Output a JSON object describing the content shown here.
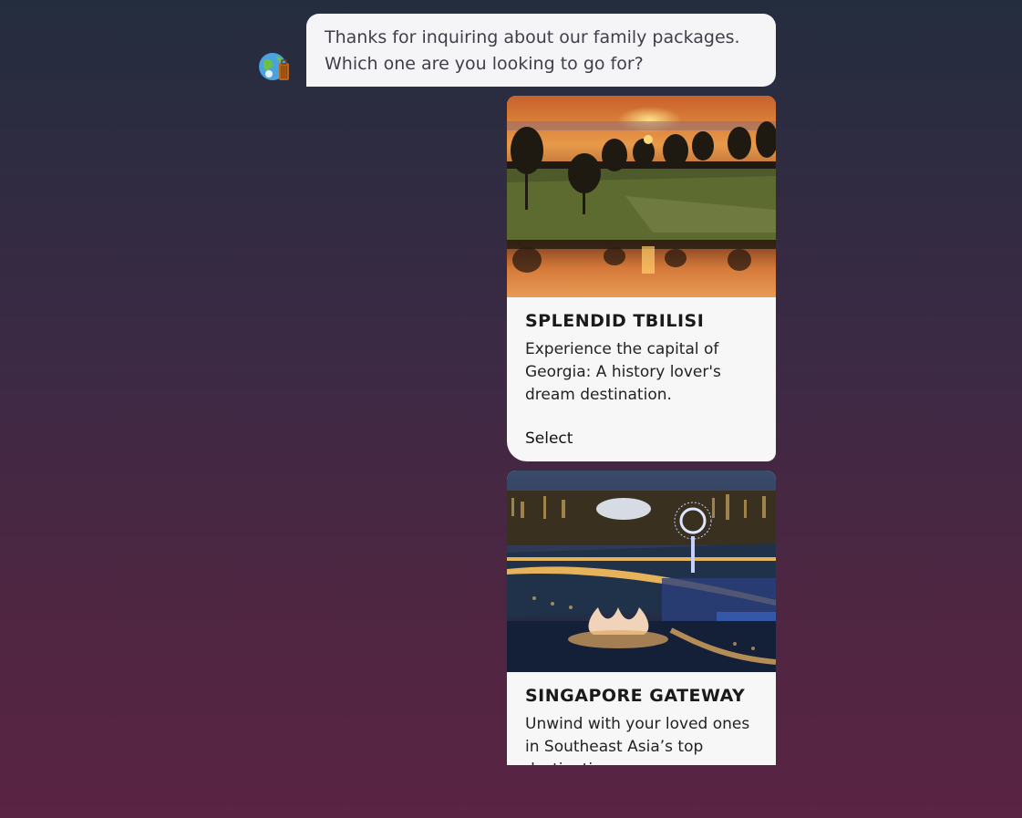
{
  "chat": {
    "bot_message": {
      "line1": "Thanks for inquiring about our family packages.",
      "line2": "Which one are you looking to go for?"
    },
    "avatar_icon": "globe-luggage-icon",
    "cards": [
      {
        "image_icon": "sunset-lake-photo",
        "title": "SPLENDID TBILISI",
        "description": "Experience the capital of Georgia: A history lover's dream destination.",
        "action": "Select"
      },
      {
        "image_icon": "singapore-skyline-photo",
        "title": "SINGAPORE GATEWAY",
        "description": "Unwind with your loved ones in Southeast Asia’s top destination."
      }
    ]
  },
  "colors": {
    "background_top": "#242d3e",
    "background_bottom": "#5a2444",
    "bubble_bg": "#f5f5f8",
    "card_bg": "#f7f7f7"
  }
}
